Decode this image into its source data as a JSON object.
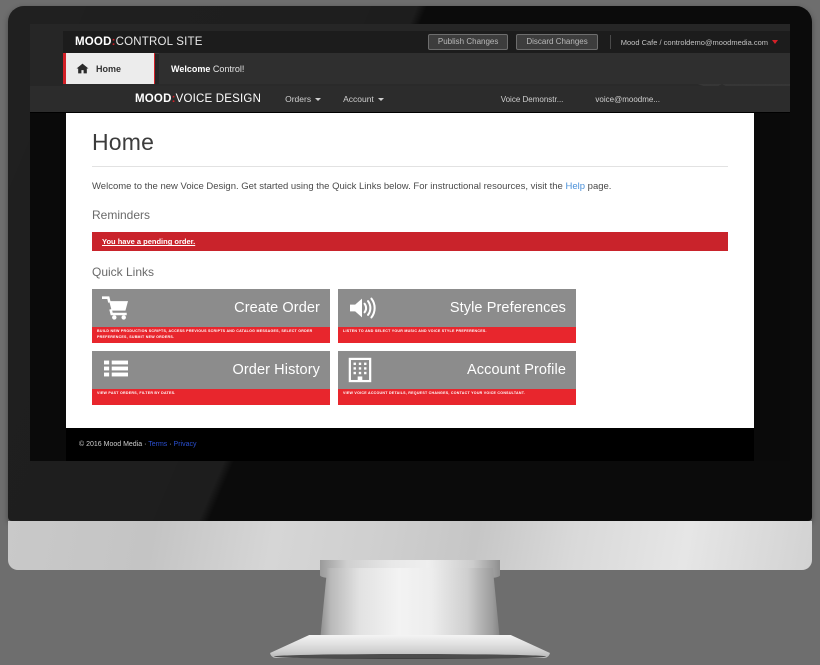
{
  "outer_app": {
    "brand_bold": "MOOD",
    "brand_colon": ":",
    "brand_light": "CONTROL SITE",
    "publish_button": "Publish Changes",
    "discard_button": "Discard Changes",
    "account_label": "Mood Cafe / controldemo@moodmedia.com",
    "home_tab": "Home",
    "home_icon": "house-icon",
    "welcome_bold": "Welcome",
    "welcome_rest": "Control!"
  },
  "voice_design": {
    "brand_bold": "MOOD",
    "brand_colon": ":",
    "brand_light": "VOICE DESIGN",
    "menu": [
      {
        "label": "Orders",
        "icon": "chevron-down-icon"
      },
      {
        "label": "Account",
        "icon": "chevron-down-icon"
      }
    ],
    "right_items": [
      "Voice Demonstr...",
      "voice@moodme..."
    ],
    "page_title": "Home",
    "intro_before": "Welcome to the new Voice Design. Get started using the Quick Links below. For instructional resources, visit the ",
    "intro_link": "Help",
    "intro_after": " page.",
    "reminders_heading": "Reminders",
    "reminder_alert": "You have a pending order.",
    "quick_links_heading": "Quick Links",
    "tiles": [
      {
        "title": "Create Order",
        "icon": "shopping-cart-icon",
        "caption": "Build new production scripts, access previous scripts and catalog messages, select order preferences, submit new orders."
      },
      {
        "title": "Style Preferences",
        "icon": "speaker-volume-icon",
        "caption": "Listen to and select your music and voice style preferences."
      },
      {
        "title": "Order History",
        "icon": "list-icon",
        "caption": "View past orders, filter by dates."
      },
      {
        "title": "Account Profile",
        "icon": "building-icon",
        "caption": "View voice account details, request changes, contact your voice consultant."
      }
    ],
    "footer_copyright": "© 2016 Mood Media · ",
    "footer_terms": "Terms",
    "footer_sep": " · ",
    "footer_privacy": "Privacy"
  },
  "colors": {
    "brand_red": "#d32027",
    "alert_red": "#c9232b",
    "caption_red": "#e8262d",
    "tile_gray": "#8c8c8c",
    "link_blue": "#4a90d9",
    "footer_link_blue": "#2a4fd0"
  }
}
